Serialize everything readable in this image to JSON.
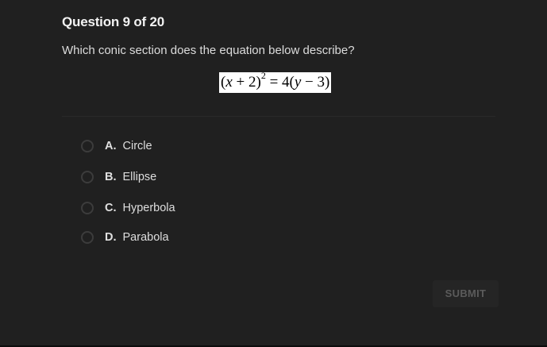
{
  "question": {
    "header": "Question 9 of 20",
    "prompt": "Which conic section does the equation below describe?",
    "equation": {
      "lhs_open": "(",
      "lhs_var": "x",
      "lhs_rest": " + 2)",
      "exponent": "2",
      "equals": " = 4(",
      "rhs_var": "y",
      "rhs_rest": " − 3)"
    }
  },
  "options": [
    {
      "letter": "A.",
      "text": "Circle"
    },
    {
      "letter": "B.",
      "text": "Ellipse"
    },
    {
      "letter": "C.",
      "text": "Hyperbola"
    },
    {
      "letter": "D.",
      "text": "Parabola"
    }
  ],
  "submit_label": "SUBMIT",
  "colors": {
    "background": "#202020",
    "text": "#e6e6e6",
    "radio_border": "#3c3c3c",
    "submit_disabled_text": "#5b5b5b"
  }
}
